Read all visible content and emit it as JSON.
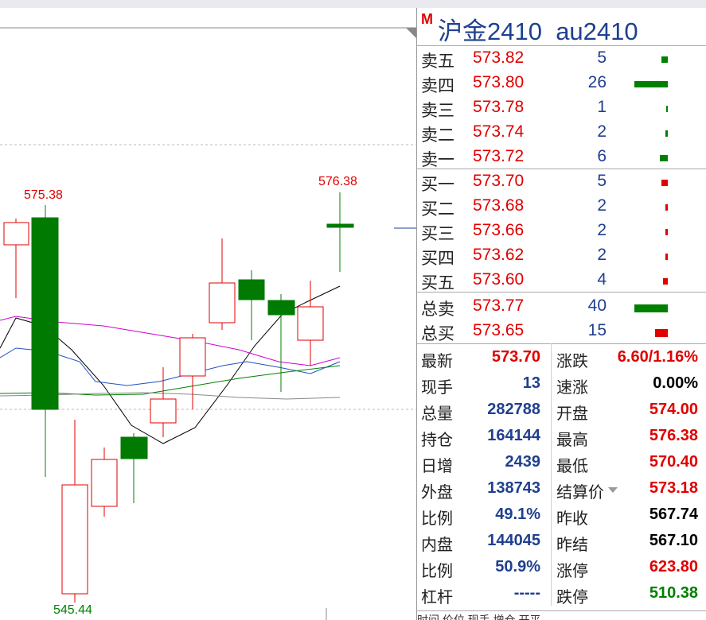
{
  "chart": {
    "high_label": "575.38",
    "high_label2": "576.38",
    "low_label": "545.44",
    "up_color": "#e00000",
    "down_color": "#008000",
    "ma_colors": [
      "#000000",
      "#d000d0",
      "#2050c0",
      "#008000",
      "#888888"
    ]
  },
  "panel": {
    "badge": "M",
    "title": "沪金2410  au2410",
    "sell": [
      {
        "label": "卖五",
        "price": "573.82",
        "vol": "5",
        "qty": 5
      },
      {
        "label": "卖四",
        "price": "573.80",
        "vol": "26",
        "qty": 26
      },
      {
        "label": "卖三",
        "price": "573.78",
        "vol": "1",
        "qty": 1
      },
      {
        "label": "卖二",
        "price": "573.74",
        "vol": "2",
        "qty": 2
      },
      {
        "label": "卖一",
        "price": "573.72",
        "vol": "6",
        "qty": 6
      }
    ],
    "buy": [
      {
        "label": "买一",
        "price": "573.70",
        "vol": "5",
        "qty": 5
      },
      {
        "label": "买二",
        "price": "573.68",
        "vol": "2",
        "qty": 2
      },
      {
        "label": "买三",
        "price": "573.66",
        "vol": "2",
        "qty": 2
      },
      {
        "label": "买四",
        "price": "573.62",
        "vol": "2",
        "qty": 2
      },
      {
        "label": "买五",
        "price": "573.60",
        "vol": "4",
        "qty": 4
      }
    ],
    "totals": [
      {
        "label": "总卖",
        "price": "573.77",
        "vol": "40",
        "qty": 40,
        "color": "#008000"
      },
      {
        "label": "总买",
        "price": "573.65",
        "vol": "15",
        "qty": 15,
        "color": "#e00000"
      }
    ],
    "stats": [
      {
        "l1": "最新",
        "v1": "573.70",
        "c1": "#e00000",
        "l2": "涨跌",
        "v2": "6.60/1.16%",
        "c2": "#e00000"
      },
      {
        "l1": "现手",
        "v1": "13",
        "c1": "#1f3f8f",
        "l2": "速涨",
        "v2": "0.00%",
        "c2": "#000000"
      },
      {
        "l1": "总量",
        "v1": "282788",
        "c1": "#1f3f8f",
        "l2": "开盘",
        "v2": "574.00",
        "c2": "#e00000"
      },
      {
        "l1": "持仓",
        "v1": "164144",
        "c1": "#1f3f8f",
        "l2": "最高",
        "v2": "576.38",
        "c2": "#e00000"
      },
      {
        "l1": "日增",
        "v1": "2439",
        "c1": "#1f3f8f",
        "l2": "最低",
        "v2": "570.40",
        "c2": "#e00000"
      },
      {
        "l1": "外盘",
        "v1": "138743",
        "c1": "#1f3f8f",
        "l2": "结算价",
        "v2": "573.18",
        "c2": "#e00000",
        "dropdown": true
      },
      {
        "l1": "比例",
        "v1": "49.1%",
        "c1": "#1f3f8f",
        "l2": "昨收",
        "v2": "567.74",
        "c2": "#000000"
      },
      {
        "l1": "内盘",
        "v1": "144045",
        "c1": "#1f3f8f",
        "l2": "昨结",
        "v2": "567.10",
        "c2": "#000000"
      },
      {
        "l1": "比例",
        "v1": "50.9%",
        "c1": "#1f3f8f",
        "l2": "涨停",
        "v2": "623.80",
        "c2": "#e00000"
      },
      {
        "l1": "杠杆",
        "v1": "-----",
        "c1": "#1f3f8f",
        "l2": "跌停",
        "v2": "510.38",
        "c2": "#008000"
      }
    ],
    "bottom_text": "时间       价位    现手    增仓    开平"
  }
}
